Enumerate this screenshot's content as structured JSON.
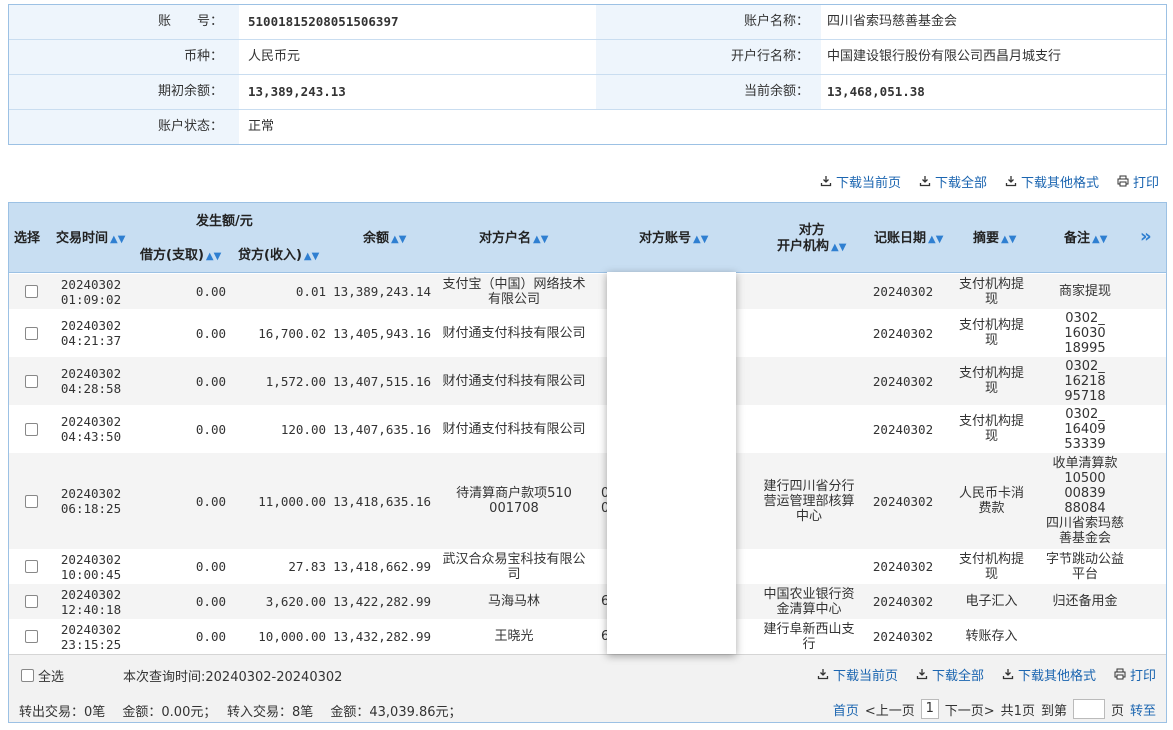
{
  "account_info": {
    "account_no_label": "账　　号：",
    "account_no": "51001815208051506397",
    "account_name_label": "账户名称：",
    "account_name": "四川省索玛慈善基金会",
    "currency_label": "币种：",
    "currency": "人民币元",
    "bank_label": "开户行名称：",
    "bank": "中国建设银行股份有限公司西昌月城支行",
    "opening_balance_label": "期初余额：",
    "opening_balance": "13,389,243.13",
    "current_balance_label": "当前余额：",
    "current_balance": "13,468,051.38",
    "status_label": "账户状态：",
    "status": "正常"
  },
  "toolbar": {
    "download_page": "下载当前页",
    "download_all": "下载全部",
    "download_other": "下载其他格式",
    "print": "打印"
  },
  "table": {
    "headers": {
      "select": "选择",
      "time": "交易时间",
      "amount_group": "发生额/元",
      "debit": "借方(支取)",
      "credit": "贷方(收入)",
      "balance": "余额",
      "cp_name": "对方户名",
      "cp_account": "对方账号",
      "cp_bank": "对方\n开户机构",
      "post_date": "记账日期",
      "summary": "摘要",
      "note": "备注",
      "more": "»"
    },
    "rows": [
      {
        "time": "20240302\n01:09:02",
        "debit": "0.00",
        "credit": "0.01",
        "balance": "13,389,243.14",
        "cp_name": "支付宝（中国）网络技术有限公司",
        "cp_account": "",
        "cp_bank": "",
        "date": "20240302",
        "summary": "支付机构提现",
        "note": "商家提现"
      },
      {
        "time": "20240302\n04:21:37",
        "debit": "0.00",
        "credit": "16,700.02",
        "balance": "13,405,943.16",
        "cp_name": "财付通支付科技有限公司",
        "cp_account": "",
        "cp_bank": "",
        "date": "20240302",
        "summary": "支付机构提现",
        "note": "0302_\n16030\n18995"
      },
      {
        "time": "20240302\n04:28:58",
        "debit": "0.00",
        "credit": "1,572.00",
        "balance": "13,407,515.16",
        "cp_name": "财付通支付科技有限公司",
        "cp_account": "",
        "cp_bank": "",
        "date": "20240302",
        "summary": "支付机构提现",
        "note": "0302_\n16218\n95718"
      },
      {
        "time": "20240302\n04:43:50",
        "debit": "0.00",
        "credit": "120.00",
        "balance": "13,407,635.16",
        "cp_name": "财付通支付科技有限公司",
        "cp_account": "",
        "cp_bank": "",
        "date": "20240302",
        "summary": "支付机构提现",
        "note": "0302_\n16409\n53339"
      },
      {
        "time": "20240302\n06:18:25",
        "debit": "0.00",
        "credit": "11,000.00",
        "balance": "13,418,635.16",
        "cp_name": "待清算商户款项510\n001708",
        "cp_account": "0　　　　　　　　　　　　0",
        "cp_bank": "建行四川省分行营运管理部核算中心",
        "date": "20240302",
        "summary": "人民币卡消费款",
        "note": "收单清算款\n10500\n00839\n88084\n四川省索玛慈善基金会"
      },
      {
        "time": "20240302\n10:00:45",
        "debit": "0.00",
        "credit": "27.83",
        "balance": "13,418,662.99",
        "cp_name": "武汉合众易宝科技有限公司",
        "cp_account": "",
        "cp_bank": "",
        "date": "20240302",
        "summary": "支付机构提现",
        "note": "字节跳动公益平台"
      },
      {
        "time": "20240302\n12:40:18",
        "debit": "0.00",
        "credit": "3,620.00",
        "balance": "13,422,282.99",
        "cp_name": "马海马林",
        "cp_account": "6",
        "cp_bank": "中国农业银行资金清算中心",
        "date": "20240302",
        "summary": "电子汇入",
        "note": "归还备用金"
      },
      {
        "time": "20240302\n23:15:25",
        "debit": "0.00",
        "credit": "10,000.00",
        "balance": "13,432,282.99",
        "cp_name": "王晓光",
        "cp_account": "6",
        "cp_bank": "建行阜新西山支行",
        "date": "20240302",
        "summary": "转账存入",
        "note": ""
      }
    ]
  },
  "footer": {
    "select_all": "全选",
    "query_time": "本次查询时间:20240302-20240302",
    "summary_line": "转出交易：0笔　 金额：0.00元；　 转入交易：8笔　 金额：43,039.86元；",
    "pager": {
      "first": "首页",
      "prev": "<上一页",
      "current": "1",
      "next": "下一页>",
      "total": "共1页",
      "goto_label": "到第",
      "page_unit": "页",
      "go": "转至"
    }
  }
}
